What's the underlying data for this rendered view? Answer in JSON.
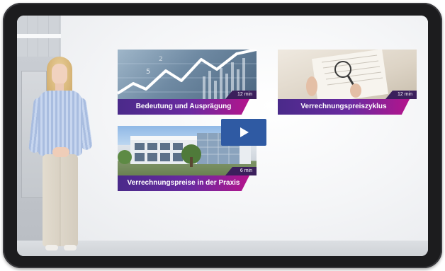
{
  "video": {
    "cards": [
      {
        "title": "Bedeutung und Ausprägung",
        "duration": "12 min"
      },
      {
        "title": "Verrechnungspreiszyklus",
        "duration": "12 min"
      },
      {
        "title": "Verrechnungspreise in der Praxis",
        "duration": "6 min"
      }
    ],
    "play_icon": "play-icon"
  },
  "colors": {
    "label_gradient_start": "#4a2a8a",
    "label_gradient_end": "#b4148c",
    "duration_bg": "#3b1f5c",
    "play_button": "#2f5aa3"
  }
}
